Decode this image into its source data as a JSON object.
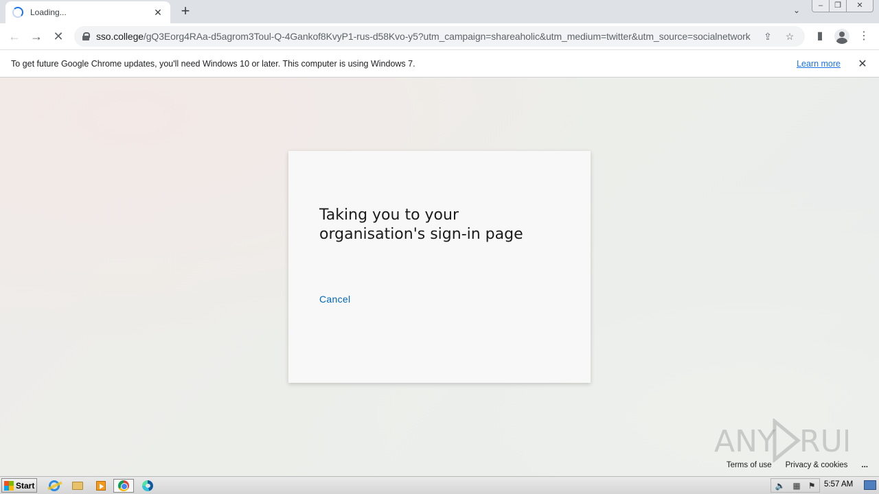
{
  "browser": {
    "tab": {
      "title": "Loading..."
    },
    "url": {
      "host": "sso.college",
      "path": "/gQ3Eorg4RAa-d5agrom3Toul-Q-4Gankof8KvyP1-rus-d58Kvo-y5?utm_campaign=shareaholic&utm_medium=twitter&utm_source=socialnetwork"
    },
    "infobar": {
      "message": "To get future Google Chrome updates, you'll need Windows 10 or later. This computer is using Windows 7.",
      "link": "Learn more"
    }
  },
  "page": {
    "heading": "Taking you to your organisation's sign-in page",
    "cancel": "Cancel",
    "footer": {
      "terms": "Terms of use",
      "privacy": "Privacy & cookies",
      "more": "..."
    },
    "watermark": "ANY RUN"
  },
  "taskbar": {
    "start": "Start",
    "clock": "5:57 AM",
    "apps": [
      "internet-explorer-icon",
      "folder-icon",
      "media-player-icon",
      "chrome-icon",
      "edge-icon"
    ]
  },
  "colors": {
    "link": "#0067b8",
    "chrome_link": "#1a73e8",
    "accent": "#1a73e8"
  }
}
